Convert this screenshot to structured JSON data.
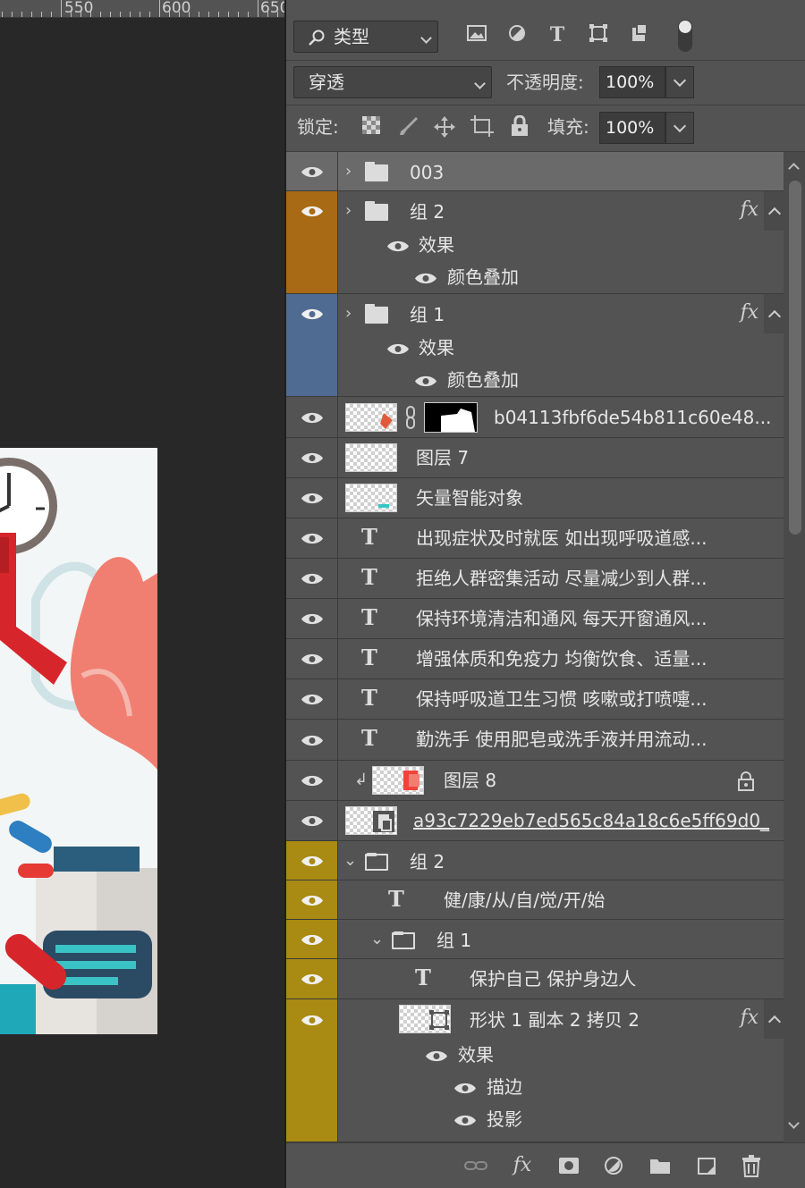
{
  "ruler": {
    "labels": [
      "550",
      "600",
      "650"
    ]
  },
  "canvas": {
    "artboard": "health-poster-preview"
  },
  "toolbar": {
    "filter_type_label": "类型",
    "blend_mode": "穿透",
    "opacity_label": "不透明度:",
    "opacity_value": "100%",
    "lock_label": "锁定:",
    "fill_label": "填充:",
    "fill_value": "100%"
  },
  "layers": [
    {
      "name": "003",
      "kind": "group",
      "color": "#535353",
      "selected": true
    },
    {
      "name": "组 2",
      "kind": "group",
      "color": "#a86a14",
      "fx": "fx",
      "effects_label": "效果",
      "effect": "颜色叠加"
    },
    {
      "name": "组 1",
      "kind": "group",
      "color": "#506b92",
      "fx": "fx",
      "effects_label": "效果",
      "effect": "颜色叠加"
    },
    {
      "name": "b04113fbf6de54b811c60e48...",
      "kind": "masked"
    },
    {
      "name": "图层 7",
      "kind": "pixel"
    },
    {
      "name": "矢量智能对象",
      "kind": "smart"
    },
    {
      "name": "出现症状及时就医 如出现呼吸道感...",
      "kind": "text"
    },
    {
      "name": "拒绝人群密集活动 尽量减少到人群...",
      "kind": "text"
    },
    {
      "name": "保持环境清洁和通风 每天开窗通风...",
      "kind": "text"
    },
    {
      "name": "增强体质和免疫力 均衡饮食、适量...",
      "kind": "text"
    },
    {
      "name": "保持呼吸道卫生习惯 咳嗽或打喷嚏...",
      "kind": "text"
    },
    {
      "name": "勤洗手 使用肥皂或洗手液并用流动...",
      "kind": "text"
    },
    {
      "name": "图层 8",
      "kind": "clipped-locked"
    },
    {
      "name": "a93c7229eb7ed565c84a18c6e5ff69d0_",
      "kind": "linked"
    },
    {
      "name": "组 2",
      "kind": "group-open",
      "color": "#a98a12"
    },
    {
      "name": "健/康/从/自/觉/开/始",
      "kind": "text",
      "color": "#a98a12"
    },
    {
      "name": "组 1",
      "kind": "group-open",
      "color": "#a98a12"
    },
    {
      "name": "保护自己 保护身边人",
      "kind": "text",
      "color": "#a98a12"
    },
    {
      "name": "形状 1 副本 2 拷贝 2",
      "kind": "shape",
      "color": "#a98a12",
      "fx": "fx",
      "effects_label": "效果",
      "effects": [
        "描边",
        "投影"
      ]
    }
  ],
  "bottom_icons": [
    "link-icon",
    "fx-icon",
    "mask-icon",
    "adjustment-icon",
    "folder-icon",
    "new-layer-icon",
    "trash-icon"
  ],
  "bottom_fx_label": "fx"
}
